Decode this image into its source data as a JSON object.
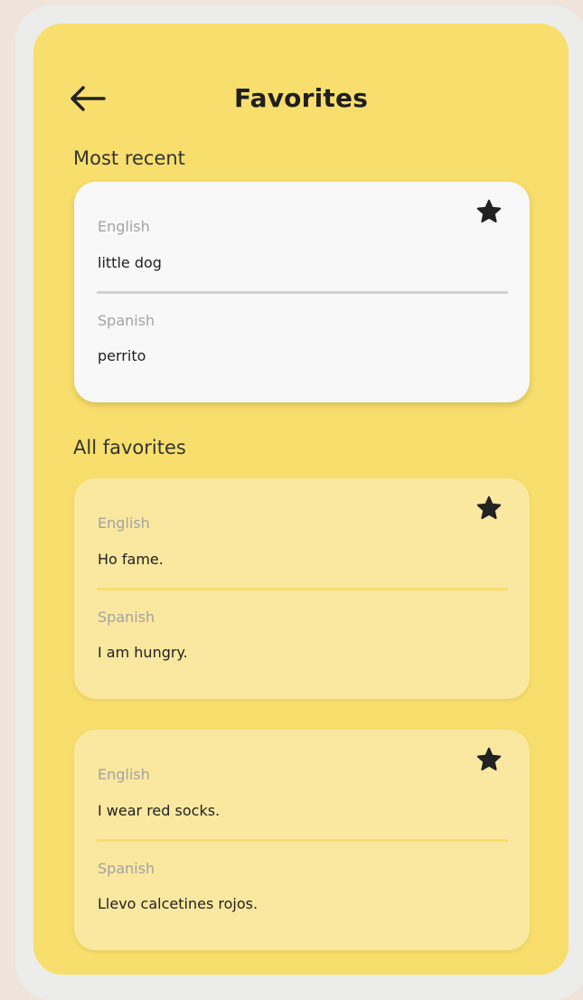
{
  "header": {
    "title": "Favorites",
    "back_icon": "arrow-left-icon"
  },
  "sections": {
    "recent_title": "Most recent",
    "all_title": "All favorites"
  },
  "recent": {
    "source_label": "English",
    "source_text": "little dog",
    "target_label": "Spanish",
    "target_text": "perrito",
    "starred": true
  },
  "favorites": [
    {
      "source_label": "English",
      "source_text": "Ho fame.",
      "target_label": "Spanish",
      "target_text": "I am hungry.",
      "starred": true
    },
    {
      "source_label": "English",
      "source_text": "I wear red socks.",
      "target_label": "Spanish",
      "target_text": "Llevo calcetines rojos.",
      "starred": true
    }
  ],
  "colors": {
    "page_background": "#efe4da",
    "screen_background": "#f8df6d",
    "recent_card": "#f8f8f8",
    "favorite_card": "#fae8a0",
    "icon": "#222222"
  }
}
